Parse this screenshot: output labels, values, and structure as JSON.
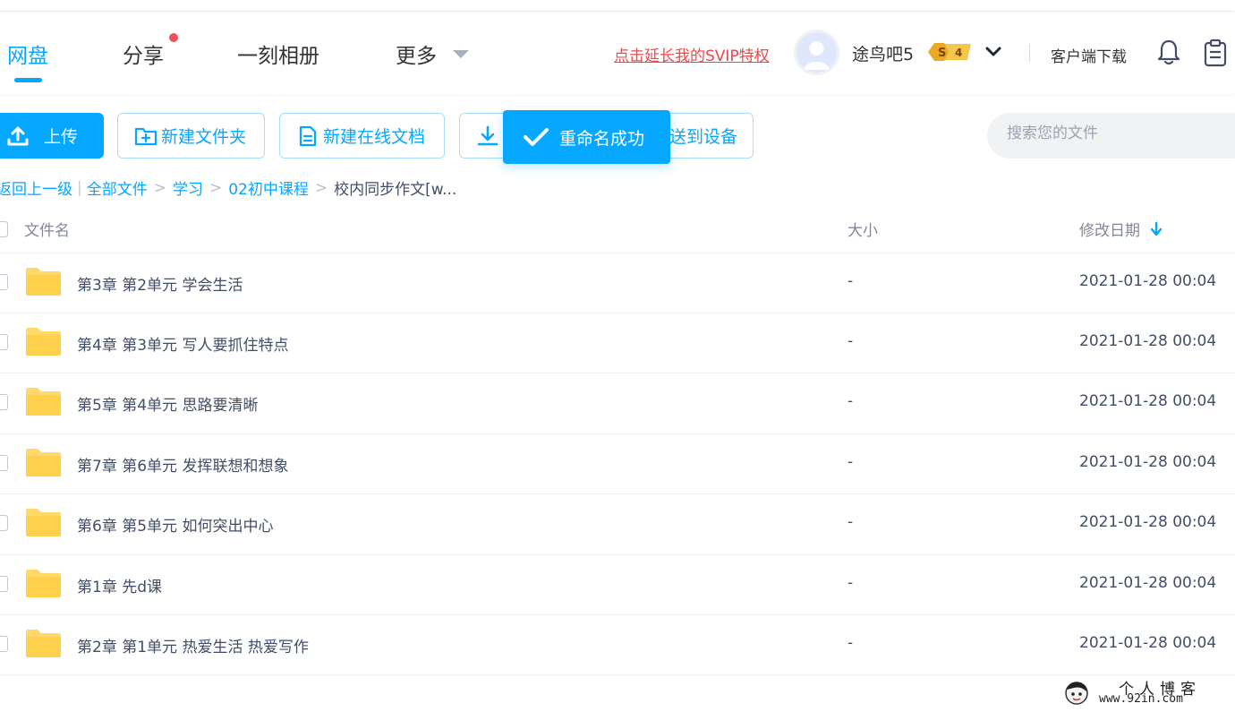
{
  "header": {
    "nav": [
      {
        "label": "网盘",
        "active": true
      },
      {
        "label": "分享",
        "has_notification_dot": true
      },
      {
        "label": "一刻相册"
      },
      {
        "label": "更多",
        "has_dropdown": true
      }
    ],
    "svip_link": "点击延长我的SVIP特权",
    "username": "途鸟吧5",
    "vip_badge": {
      "letter": "S",
      "level": "4"
    },
    "client_download": "客户端下载",
    "icons": [
      "chevron-down-icon",
      "bell-icon",
      "clipboard-icon"
    ]
  },
  "toolbar": {
    "upload": "上传",
    "new_folder": "新建文件夹",
    "new_online_doc": "新建在线文档",
    "send_to_device": "送到设备",
    "search_placeholder": "搜索您的文件"
  },
  "toast": {
    "message": "重命名成功",
    "icon": "check-icon"
  },
  "breadcrumb": {
    "back": "返回上一级",
    "items": [
      "全部文件",
      "学习",
      "02初中课程"
    ],
    "current": "校内同步作文[w..."
  },
  "table": {
    "columns": {
      "name": "文件名",
      "size": "大小",
      "date": "修改日期"
    },
    "sort": "date-descending",
    "rows": [
      {
        "name": "第3章 第2单元 学会生活",
        "size": "-",
        "date": "2021-01-28 00:04"
      },
      {
        "name": "第4章 第3单元 写人要抓住特点",
        "size": "-",
        "date": "2021-01-28 00:04"
      },
      {
        "name": "第5章 第4单元 思路要清晰",
        "size": "-",
        "date": "2021-01-28 00:04"
      },
      {
        "name": "第7章 第6单元 发挥联想和想象",
        "size": "-",
        "date": "2021-01-28 00:04"
      },
      {
        "name": "第6章 第5单元 如何突出中心",
        "size": "-",
        "date": "2021-01-28 00:04"
      },
      {
        "name": "第1章 先d课",
        "size": "-",
        "date": "2021-01-28 00:04"
      },
      {
        "name": "第2章 第1单元 热爱生活 热爱写作",
        "size": "-",
        "date": "2021-01-28 00:04"
      }
    ]
  },
  "watermark": {
    "title": "个人博客",
    "url": "www.92in.com"
  },
  "colors": {
    "accent": "#06a7ff",
    "svip_red": "#f2444a",
    "folder": "#ffd96a",
    "text": "#424e67"
  }
}
